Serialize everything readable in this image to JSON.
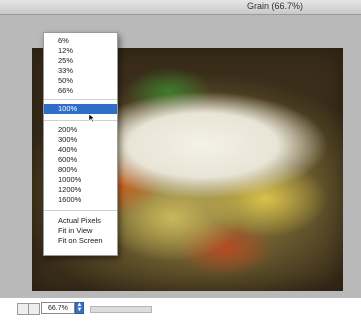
{
  "window": {
    "title": "Grain (66.7%)"
  },
  "zoom_menu": {
    "group1": [
      "6%",
      "12%",
      "25%",
      "33%",
      "50%",
      "66%"
    ],
    "selected": "100%",
    "group2": [
      "200%",
      "300%",
      "400%",
      "600%",
      "800%",
      "1000%",
      "1200%",
      "1600%"
    ],
    "group3": [
      "Actual Pixels",
      "Fit in View",
      "Fit on Screen"
    ]
  },
  "statusbar": {
    "zoom_value": "66.7%",
    "left_icon": "page-icon",
    "right_icon": "page-icon",
    "stepper_icon": "up-down-arrows-icon"
  },
  "colors": {
    "selection": "#2f6ec7",
    "canvas": "#b9b9b9"
  }
}
